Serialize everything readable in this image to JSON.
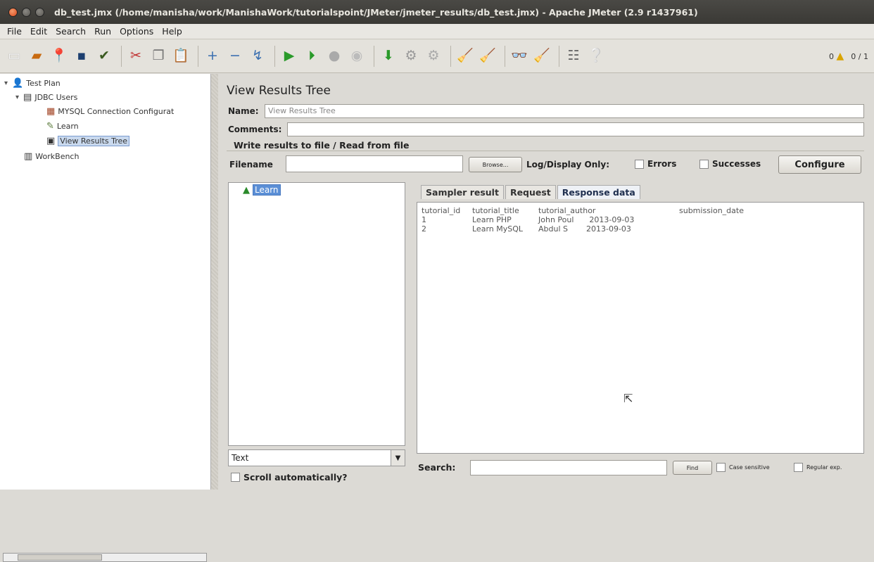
{
  "window": {
    "title": "db_test.jmx (/home/manisha/work/ManishaWork/tutorialspoint/JMeter/jmeter_results/db_test.jmx) - Apache JMeter (2.9 r1437961)"
  },
  "menu": [
    {
      "label": "File"
    },
    {
      "label": "Edit"
    },
    {
      "label": "Search"
    },
    {
      "label": "Run"
    },
    {
      "label": "Options"
    },
    {
      "label": "Help"
    }
  ],
  "toolbar": {
    "warnings": "0",
    "threads": "0 / 1"
  },
  "tree": {
    "test_plan": "Test Plan",
    "jdbc_users": "JDBC Users",
    "mysql_config": "MYSQL Connection Configurat",
    "learn": "Learn",
    "view_results": "View Results Tree",
    "workbench": "WorkBench"
  },
  "panel": {
    "title": "View Results Tree",
    "name_label": "Name:",
    "name_value": "View Results Tree",
    "comments_label": "Comments:",
    "group_title": "Write results to file / Read from file",
    "filename_label": "Filename",
    "browse": "Browse...",
    "log_display": "Log/Display Only:",
    "errors": "Errors",
    "successes": "Successes",
    "configure": "Configure"
  },
  "results": {
    "item": "Learn",
    "renderer": "Text",
    "scroll_auto": "Scroll automatically?"
  },
  "tabs": [
    {
      "label": "Sampler result"
    },
    {
      "label": "Request"
    },
    {
      "label": "Response data"
    }
  ],
  "response": {
    "headers": [
      "tutorial_id",
      "tutorial_title",
      "tutorial_author",
      "submission_date"
    ],
    "rows": [
      [
        "1",
        "Learn PHP",
        "John Poul",
        "2013-09-03"
      ],
      [
        "2",
        "Learn MySQL",
        "Abdul S",
        "2013-09-03"
      ]
    ]
  },
  "search": {
    "label": "Search:",
    "find": "Find",
    "case_sensitive": "Case sensitive",
    "regular_exp": "Regular exp."
  }
}
